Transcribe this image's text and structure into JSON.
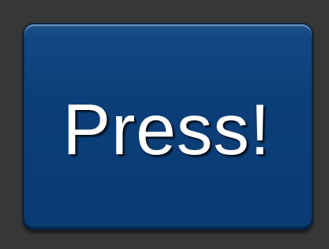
{
  "button": {
    "label": "Press!"
  },
  "colors": {
    "background": "#373737",
    "button_fill": "#0b3f79",
    "button_border": "#0a1f3e",
    "label_text": "#ffffff"
  }
}
